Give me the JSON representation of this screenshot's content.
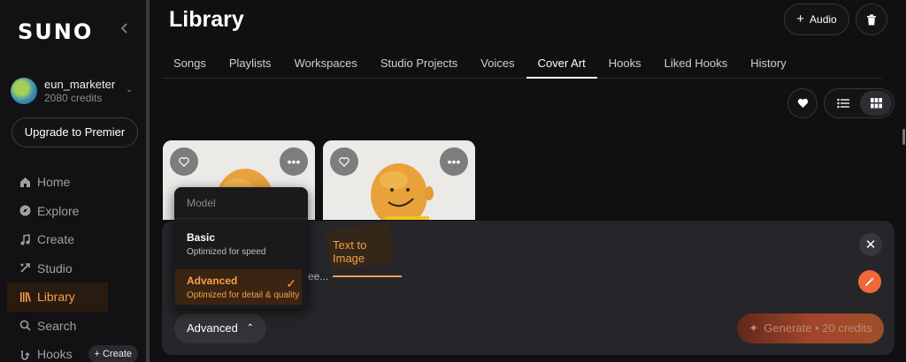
{
  "sidebar": {
    "logo": "SUNO",
    "user": {
      "name": "eun_marketer",
      "credits": "2080 credits"
    },
    "upgrade_label": "Upgrade to Premier",
    "items": [
      {
        "label": "Home",
        "icon": "home-icon"
      },
      {
        "label": "Explore",
        "icon": "compass-icon"
      },
      {
        "label": "Create",
        "icon": "music-note-icon"
      },
      {
        "label": "Studio",
        "icon": "studio-icon"
      },
      {
        "label": "Library",
        "icon": "library-icon",
        "active": true
      },
      {
        "label": "Search",
        "icon": "search-icon"
      },
      {
        "label": "Hooks",
        "icon": "hooks-icon"
      }
    ],
    "create_chip": "+ Create"
  },
  "header": {
    "title": "Library",
    "audio_label": "Audio"
  },
  "tabs": [
    "Songs",
    "Playlists",
    "Workspaces",
    "Studio Projects",
    "Voices",
    "Cover Art",
    "Hooks",
    "Liked Hooks",
    "History"
  ],
  "active_tab": "Cover Art",
  "panel": {
    "tab_video_partial": "eo",
    "tab_image": "Text to Image",
    "prompt_partial": "ee...",
    "model_value": "Advanced",
    "generate_label": "Generate • 20 credits"
  },
  "dropdown": {
    "header": "Model",
    "options": [
      {
        "title": "Basic",
        "subtitle": "Optimized for speed",
        "selected": false
      },
      {
        "title": "Advanced",
        "subtitle": "Optimized for detail & quality",
        "selected": true
      }
    ]
  },
  "colors": {
    "accent": "#f4a04a",
    "magic": "#f0683a"
  }
}
